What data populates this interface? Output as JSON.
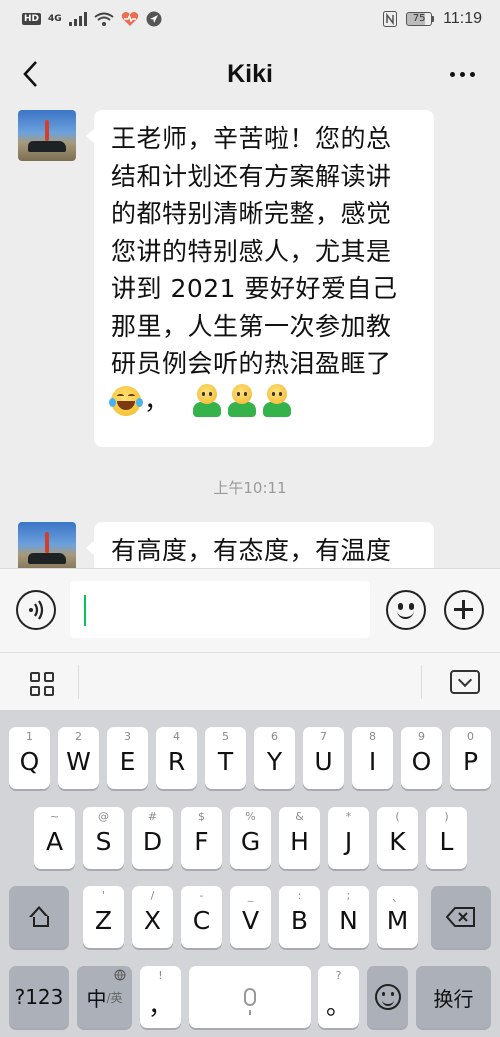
{
  "status_bar": {
    "hd": "HD",
    "network": "4G",
    "battery": "75",
    "time": "11:19"
  },
  "header": {
    "title": "Kiki"
  },
  "chat": {
    "messages": [
      {
        "sender": "Kiki",
        "lines": [
          "王老师，辛苦啦！您的总",
          "结和计划还有方案解读讲",
          "的都特别清晰完整，感觉",
          "您讲的特别感人，尤其是",
          "讲到 2021 要好好爱自己",
          "那里，人生第一次参加教",
          "研员例会听的热泪盈眶了"
        ],
        "emoji_line": {
          "punct": "，",
          "emojis": [
            "laughing-tears",
            "green-shirt-person",
            "green-shirt-person",
            "green-shirt-person"
          ]
        }
      },
      {
        "sender": "Kiki",
        "lines": [
          "有高度，有态度，有温度"
        ]
      }
    ],
    "timestamp": "上午10:11"
  },
  "input": {
    "value": "",
    "placeholder": ""
  },
  "keyboard": {
    "row1": [
      {
        "hint": "1",
        "key": "Q"
      },
      {
        "hint": "2",
        "key": "W"
      },
      {
        "hint": "3",
        "key": "E"
      },
      {
        "hint": "4",
        "key": "R"
      },
      {
        "hint": "5",
        "key": "T"
      },
      {
        "hint": "6",
        "key": "Y"
      },
      {
        "hint": "7",
        "key": "U"
      },
      {
        "hint": "8",
        "key": "I"
      },
      {
        "hint": "9",
        "key": "O"
      },
      {
        "hint": "0",
        "key": "P"
      }
    ],
    "row2": [
      {
        "hint": "~",
        "key": "A"
      },
      {
        "hint": "@",
        "key": "S"
      },
      {
        "hint": "#",
        "key": "D"
      },
      {
        "hint": "$",
        "key": "F"
      },
      {
        "hint": "%",
        "key": "G"
      },
      {
        "hint": "&",
        "key": "H"
      },
      {
        "hint": "*",
        "key": "J"
      },
      {
        "hint": "(",
        "key": "K"
      },
      {
        "hint": ")",
        "key": "L"
      }
    ],
    "row3": [
      {
        "hint": "'",
        "key": "Z"
      },
      {
        "hint": "/",
        "key": "X"
      },
      {
        "hint": "-",
        "key": "C"
      },
      {
        "hint": "_",
        "key": "V"
      },
      {
        "hint": ":",
        "key": "B"
      },
      {
        "hint": ";",
        "key": "N"
      },
      {
        "hint": "、",
        "key": "M"
      }
    ],
    "row4": {
      "symbols": "?123",
      "lang_main": "中",
      "lang_sub": "/英",
      "comma_hint": "!",
      "comma": "，",
      "period_hint": "?",
      "period": "。",
      "enter": "换行"
    }
  }
}
